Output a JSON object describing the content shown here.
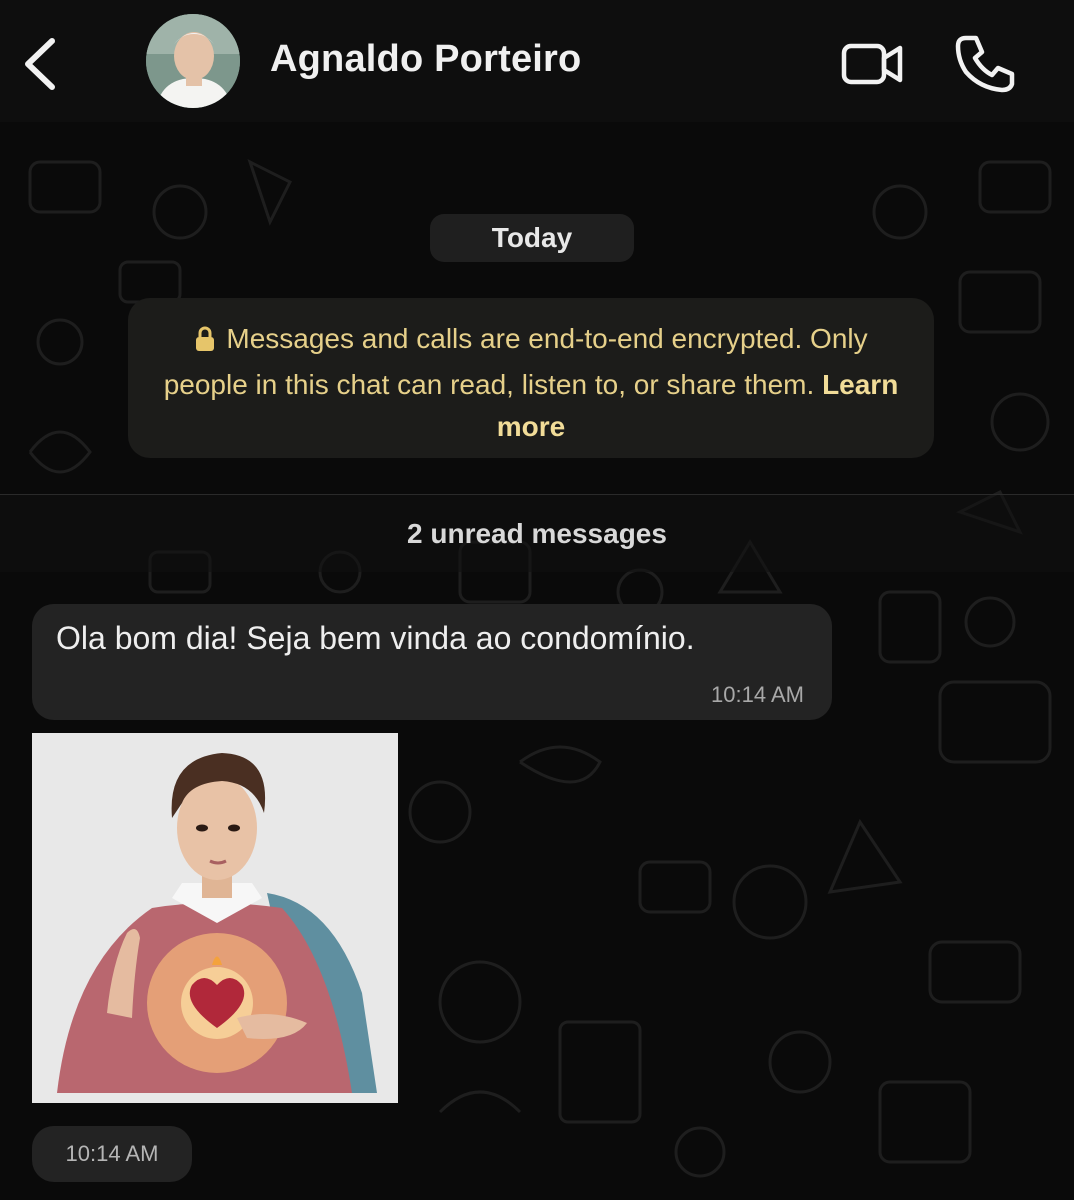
{
  "header": {
    "contact_name": "Agnaldo Porteiro",
    "back_icon": "chevron-left-icon",
    "video_icon": "video-camera-icon",
    "call_icon": "phone-icon"
  },
  "chat": {
    "date_label": "Today",
    "encryption": {
      "icon": "lock-icon",
      "text": "Messages and calls are end-to-end encrypted. Only people in this chat can read, listen to, or share them.",
      "link": "Learn more"
    },
    "unread_label": "2 unread messages",
    "messages": [
      {
        "type": "text",
        "text": "Ola bom dia! Seja bem vinda ao condomínio.",
        "time": "10:14 AM"
      },
      {
        "type": "sticker",
        "time": "10:14 AM"
      }
    ]
  },
  "colors": {
    "background": "#0a0a0a",
    "bubble": "#232323",
    "encryption_text": "#e6d08a"
  }
}
